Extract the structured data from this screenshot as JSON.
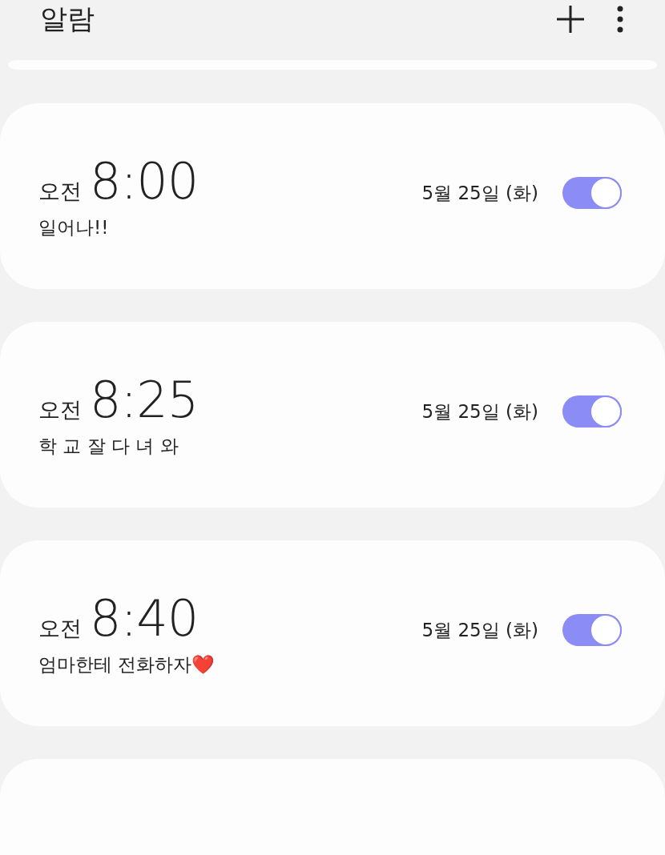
{
  "header": {
    "title": "알람"
  },
  "alarms": [
    {
      "period": "오전",
      "time": "8:00",
      "label": "일어나!!",
      "date": "5월 25일 (화)",
      "on": true
    },
    {
      "period": "오전",
      "time": "8:25",
      "label": "학 교 잘 다 녀 와",
      "date": "5월 25일 (화)",
      "on": true
    },
    {
      "period": "오전",
      "time": "8:40",
      "label": "엄마한테 전화하자❤️",
      "date": "5월 25일 (화)",
      "on": true
    }
  ]
}
